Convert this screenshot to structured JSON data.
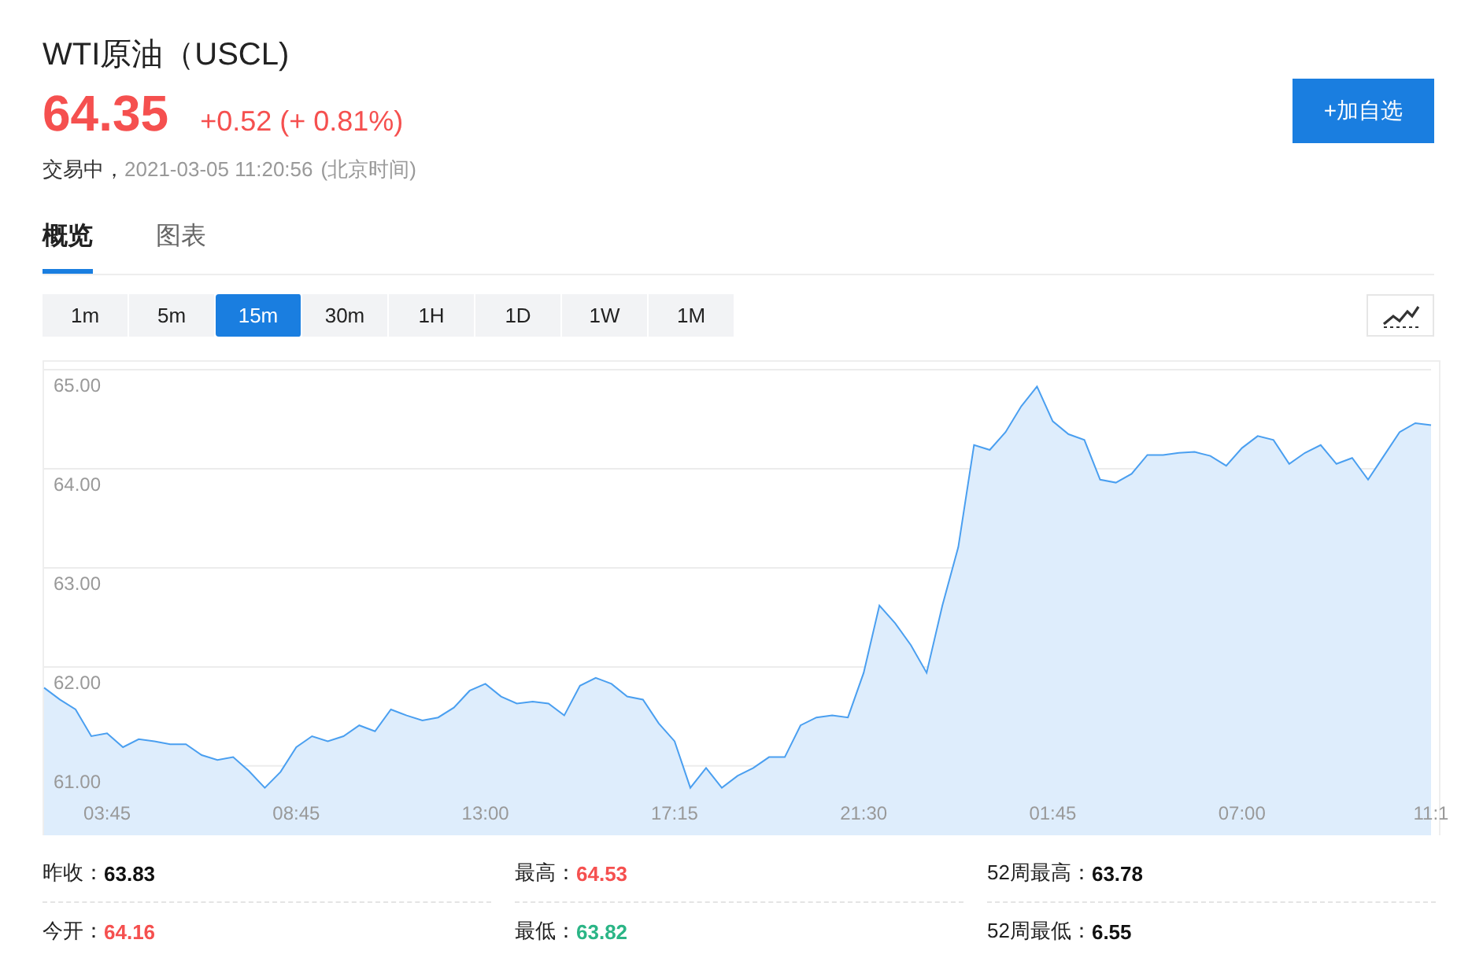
{
  "title": "WTI原油（USCL)",
  "price": {
    "value": "64.35",
    "change": "+0.52 (+ 0.81%)"
  },
  "status": {
    "state": "交易中，",
    "time": "2021-03-05 11:20:56",
    "zone": "(北京时间)"
  },
  "add_button": "+加自选",
  "tabs": [
    {
      "label": "概览",
      "selected": true
    },
    {
      "label": "图表",
      "selected": false
    }
  ],
  "ranges": [
    {
      "label": "1m",
      "selected": false
    },
    {
      "label": "5m",
      "selected": false
    },
    {
      "label": "15m",
      "selected": true
    },
    {
      "label": "30m",
      "selected": false
    },
    {
      "label": "1H",
      "selected": false
    },
    {
      "label": "1D",
      "selected": false
    },
    {
      "label": "1W",
      "selected": false
    },
    {
      "label": "1M",
      "selected": false
    }
  ],
  "chart": {
    "chart_data": {
      "type": "area",
      "ylim": [
        60.3,
        65.08
      ],
      "grid": true,
      "categories": [
        null,
        null,
        null,
        null,
        "03:45",
        null,
        null,
        null,
        null,
        null,
        null,
        null,
        null,
        null,
        null,
        null,
        "08:45",
        null,
        null,
        null,
        null,
        null,
        null,
        null,
        null,
        null,
        null,
        null,
        "13:00",
        null,
        null,
        null,
        null,
        null,
        null,
        null,
        null,
        null,
        null,
        null,
        "17:15",
        null,
        null,
        null,
        null,
        null,
        null,
        null,
        null,
        null,
        null,
        null,
        "21:30",
        null,
        null,
        null,
        null,
        null,
        null,
        null,
        null,
        null,
        null,
        null,
        "01:45",
        null,
        null,
        null,
        null,
        null,
        null,
        null,
        null,
        null,
        null,
        null,
        "07:00",
        null,
        null,
        null,
        null,
        null,
        null,
        null,
        null,
        null,
        null,
        null,
        "11:1"
      ],
      "yticks": [
        {
          "value": 61,
          "label": "61.00"
        },
        {
          "value": 62,
          "label": "62.00"
        },
        {
          "value": 63,
          "label": "63.00"
        },
        {
          "value": 64,
          "label": "64.00"
        },
        {
          "value": 65,
          "label": "65.00"
        }
      ],
      "series": [
        {
          "color": "#4a9ff0",
          "values": [
            61.79,
            61.67,
            61.57,
            61.3,
            61.33,
            61.19,
            61.27,
            61.25,
            61.22,
            61.22,
            61.11,
            61.06,
            61.09,
            60.95,
            60.78,
            60.94,
            61.19,
            61.3,
            61.25,
            61.3,
            61.41,
            61.35,
            61.57,
            61.51,
            61.46,
            61.49,
            61.59,
            61.76,
            61.83,
            61.7,
            61.63,
            61.65,
            61.63,
            61.51,
            61.81,
            61.89,
            61.83,
            61.7,
            61.67,
            61.43,
            61.25,
            60.78,
            60.98,
            60.78,
            60.9,
            60.98,
            61.09,
            61.09,
            61.41,
            61.49,
            61.51,
            61.49,
            61.94,
            62.62,
            62.44,
            62.22,
            61.94,
            62.62,
            63.21,
            64.24,
            64.19,
            64.37,
            64.63,
            64.83,
            64.48,
            64.35,
            64.29,
            63.89,
            63.86,
            63.95,
            64.14,
            64.14,
            64.16,
            64.17,
            64.13,
            64.03,
            64.21,
            64.33,
            64.29,
            64.05,
            64.16,
            64.24,
            64.05,
            64.11,
            63.89,
            64.13,
            64.37,
            64.46,
            64.44
          ]
        }
      ]
    }
  },
  "stats": [
    {
      "label": "昨收：",
      "value": "63.83",
      "color": "#111111"
    },
    {
      "label": "最高：",
      "value": "64.53",
      "color": "#f5504f"
    },
    {
      "label": "52周最高：",
      "value": "63.78",
      "color": "#111111"
    },
    {
      "label": "今开：",
      "value": "64.16",
      "color": "#f5504f"
    },
    {
      "label": "最低：",
      "value": "63.82",
      "color": "#2bb586"
    },
    {
      "label": "52周最低：",
      "value": "6.55",
      "color": "#111111"
    }
  ]
}
